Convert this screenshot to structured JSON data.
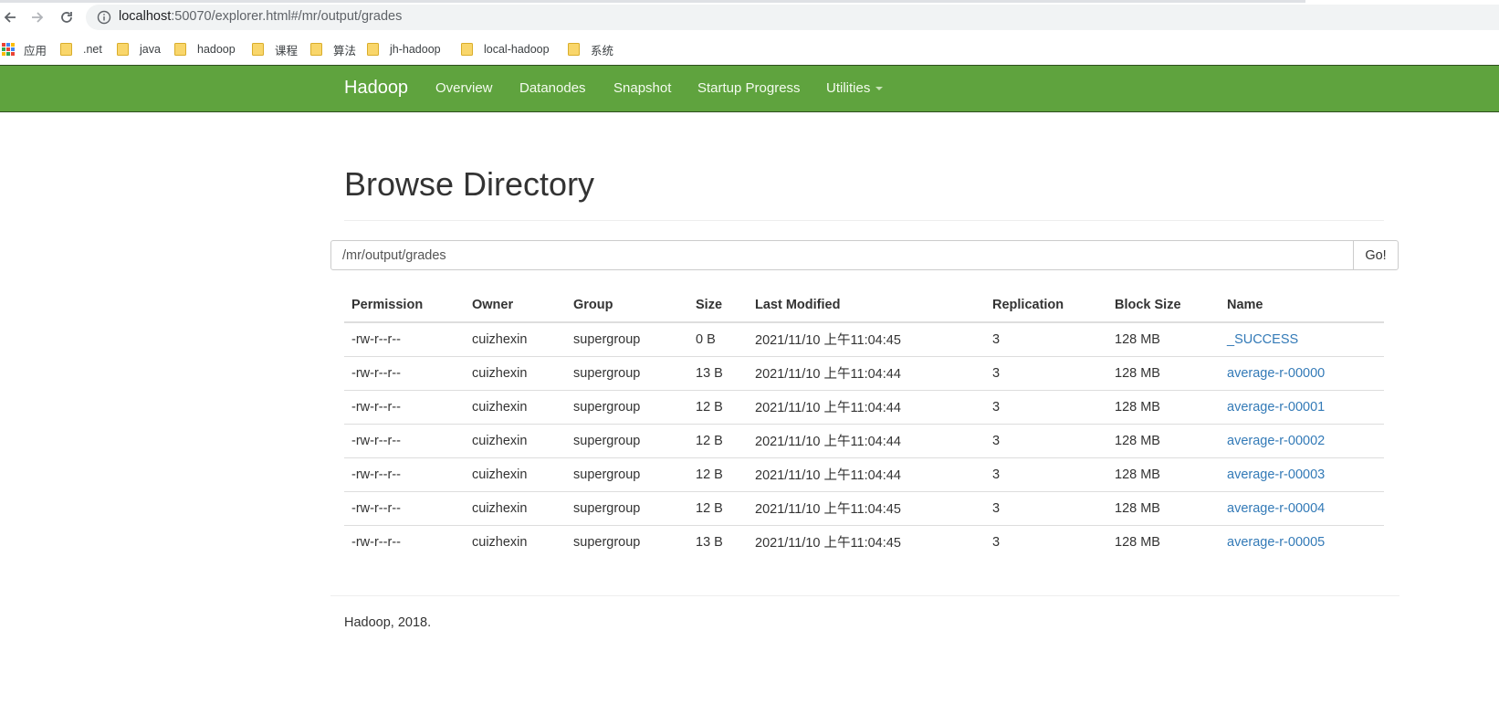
{
  "browser": {
    "url_host": "localhost",
    "url_rest": ":50070/explorer.html#/mr/output/grades"
  },
  "bookmarks": [
    {
      "label": "应用",
      "type": "apps"
    },
    {
      "label": ".net",
      "type": "folder"
    },
    {
      "label": "java",
      "type": "folder"
    },
    {
      "label": "hadoop",
      "type": "folder"
    },
    {
      "label": "课程",
      "type": "folder"
    },
    {
      "label": "算法",
      "type": "folder"
    },
    {
      "label": "jh-hadoop",
      "type": "folder"
    },
    {
      "label": "local-hadoop",
      "type": "folder"
    },
    {
      "label": "系统",
      "type": "folder"
    }
  ],
  "navbar": {
    "brand": "Hadoop",
    "links": [
      "Overview",
      "Datanodes",
      "Snapshot",
      "Startup Progress",
      "Utilities"
    ],
    "color": "#5fa33e"
  },
  "page": {
    "title": "Browse Directory",
    "path_value": "/mr/output/grades",
    "go_label": "Go!"
  },
  "table": {
    "headers": [
      "Permission",
      "Owner",
      "Group",
      "Size",
      "Last Modified",
      "Replication",
      "Block Size",
      "Name"
    ],
    "rows": [
      [
        "-rw-r--r--",
        "cuizhexin",
        "supergroup",
        "0 B",
        "2021/11/10 上午11:04:45",
        "3",
        "128 MB",
        "_SUCCESS"
      ],
      [
        "-rw-r--r--",
        "cuizhexin",
        "supergroup",
        "13 B",
        "2021/11/10 上午11:04:44",
        "3",
        "128 MB",
        "average-r-00000"
      ],
      [
        "-rw-r--r--",
        "cuizhexin",
        "supergroup",
        "12 B",
        "2021/11/10 上午11:04:44",
        "3",
        "128 MB",
        "average-r-00001"
      ],
      [
        "-rw-r--r--",
        "cuizhexin",
        "supergroup",
        "12 B",
        "2021/11/10 上午11:04:44",
        "3",
        "128 MB",
        "average-r-00002"
      ],
      [
        "-rw-r--r--",
        "cuizhexin",
        "supergroup",
        "12 B",
        "2021/11/10 上午11:04:44",
        "3",
        "128 MB",
        "average-r-00003"
      ],
      [
        "-rw-r--r--",
        "cuizhexin",
        "supergroup",
        "12 B",
        "2021/11/10 上午11:04:45",
        "3",
        "128 MB",
        "average-r-00004"
      ],
      [
        "-rw-r--r--",
        "cuizhexin",
        "supergroup",
        "13 B",
        "2021/11/10 上午11:04:45",
        "3",
        "128 MB",
        "average-r-00005"
      ]
    ],
    "link_color": "#337ab7"
  },
  "footer": {
    "text": "Hadoop, 2018."
  }
}
